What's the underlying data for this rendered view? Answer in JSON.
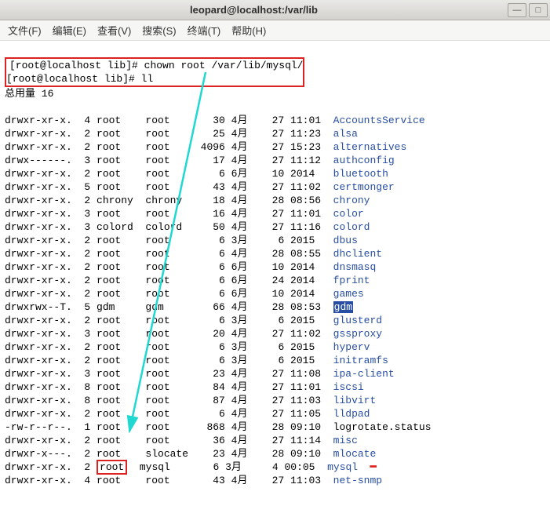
{
  "window": {
    "title": "leopard@localhost:/var/lib",
    "min": "—",
    "max": "□"
  },
  "menu": {
    "file": "文件(F)",
    "edit": "编辑(E)",
    "view": "查看(V)",
    "search": "搜索(S)",
    "terminal": "终端(T)",
    "help": "帮助(H)"
  },
  "prompt1_pre": "[root@localhost lib]# ",
  "cmd1": "chown root /var/lib/mysql/",
  "prompt2_pre": "[root@localhost lib]# ",
  "cmd2": "ll",
  "total": "总用量 16",
  "rows": [
    {
      "perm": "drwxr-xr-x.",
      "n": "4",
      "own": "root",
      "grp": "root",
      "sz": "30",
      "mon": "4月",
      "day": "27",
      "time": "11:01",
      "name": "AccountsService",
      "cls": "blue"
    },
    {
      "perm": "drwxr-xr-x.",
      "n": "2",
      "own": "root",
      "grp": "root",
      "sz": "25",
      "mon": "4月",
      "day": "27",
      "time": "11:23",
      "name": "alsa",
      "cls": "blue"
    },
    {
      "perm": "drwxr-xr-x.",
      "n": "2",
      "own": "root",
      "grp": "root",
      "sz": "4096",
      "mon": "4月",
      "day": "27",
      "time": "15:23",
      "name": "alternatives",
      "cls": "blue"
    },
    {
      "perm": "drwx------.",
      "n": "3",
      "own": "root",
      "grp": "root",
      "sz": "17",
      "mon": "4月",
      "day": "27",
      "time": "11:12",
      "name": "authconfig",
      "cls": "blue"
    },
    {
      "perm": "drwxr-xr-x.",
      "n": "2",
      "own": "root",
      "grp": "root",
      "sz": "6",
      "mon": "6月",
      "day": "10",
      "time": "2014",
      "name": "bluetooth",
      "cls": "blue"
    },
    {
      "perm": "drwxr-xr-x.",
      "n": "5",
      "own": "root",
      "grp": "root",
      "sz": "43",
      "mon": "4月",
      "day": "27",
      "time": "11:02",
      "name": "certmonger",
      "cls": "blue"
    },
    {
      "perm": "drwxr-xr-x.",
      "n": "2",
      "own": "chrony",
      "grp": "chrony",
      "sz": "18",
      "mon": "4月",
      "day": "28",
      "time": "08:56",
      "name": "chrony",
      "cls": "blue"
    },
    {
      "perm": "drwxr-xr-x.",
      "n": "3",
      "own": "root",
      "grp": "root",
      "sz": "16",
      "mon": "4月",
      "day": "27",
      "time": "11:01",
      "name": "color",
      "cls": "blue"
    },
    {
      "perm": "drwxr-xr-x.",
      "n": "3",
      "own": "colord",
      "grp": "colord",
      "sz": "50",
      "mon": "4月",
      "day": "27",
      "time": "11:16",
      "name": "colord",
      "cls": "blue"
    },
    {
      "perm": "drwxr-xr-x.",
      "n": "2",
      "own": "root",
      "grp": "root",
      "sz": "6",
      "mon": "3月",
      "day": "6",
      "time": "2015",
      "name": "dbus",
      "cls": "blue"
    },
    {
      "perm": "drwxr-xr-x.",
      "n": "2",
      "own": "root",
      "grp": "root",
      "sz": "6",
      "mon": "4月",
      "day": "28",
      "time": "08:55",
      "name": "dhclient",
      "cls": "blue"
    },
    {
      "perm": "drwxr-xr-x.",
      "n": "2",
      "own": "root",
      "grp": "root",
      "sz": "6",
      "mon": "6月",
      "day": "10",
      "time": "2014",
      "name": "dnsmasq",
      "cls": "blue"
    },
    {
      "perm": "drwxr-xr-x.",
      "n": "2",
      "own": "root",
      "grp": "root",
      "sz": "6",
      "mon": "6月",
      "day": "24",
      "time": "2014",
      "name": "fprint",
      "cls": "blue"
    },
    {
      "perm": "drwxr-xr-x.",
      "n": "2",
      "own": "root",
      "grp": "root",
      "sz": "6",
      "mon": "6月",
      "day": "10",
      "time": "2014",
      "name": "games",
      "cls": "blue"
    },
    {
      "perm": "drwxrwx--T.",
      "n": "5",
      "own": "gdm",
      "grp": "gdm",
      "sz": "66",
      "mon": "4月",
      "day": "28",
      "time": "08:53",
      "name": "gdm",
      "cls": "gdm"
    },
    {
      "perm": "drwxr-xr-x.",
      "n": "2",
      "own": "root",
      "grp": "root",
      "sz": "6",
      "mon": "3月",
      "day": "6",
      "time": "2015",
      "name": "glusterd",
      "cls": "blue"
    },
    {
      "perm": "drwxr-xr-x.",
      "n": "3",
      "own": "root",
      "grp": "root",
      "sz": "20",
      "mon": "4月",
      "day": "27",
      "time": "11:02",
      "name": "gssproxy",
      "cls": "blue"
    },
    {
      "perm": "drwxr-xr-x.",
      "n": "2",
      "own": "root",
      "grp": "root",
      "sz": "6",
      "mon": "3月",
      "day": "6",
      "time": "2015",
      "name": "hyperv",
      "cls": "blue"
    },
    {
      "perm": "drwxr-xr-x.",
      "n": "2",
      "own": "root",
      "grp": "root",
      "sz": "6",
      "mon": "3月",
      "day": "6",
      "time": "2015",
      "name": "initramfs",
      "cls": "blue"
    },
    {
      "perm": "drwxr-xr-x.",
      "n": "3",
      "own": "root",
      "grp": "root",
      "sz": "23",
      "mon": "4月",
      "day": "27",
      "time": "11:08",
      "name": "ipa-client",
      "cls": "blue"
    },
    {
      "perm": "drwxr-xr-x.",
      "n": "8",
      "own": "root",
      "grp": "root",
      "sz": "84",
      "mon": "4月",
      "day": "27",
      "time": "11:01",
      "name": "iscsi",
      "cls": "blue"
    },
    {
      "perm": "drwxr-xr-x.",
      "n": "8",
      "own": "root",
      "grp": "root",
      "sz": "87",
      "mon": "4月",
      "day": "27",
      "time": "11:03",
      "name": "libvirt",
      "cls": "blue"
    },
    {
      "perm": "drwxr-xr-x.",
      "n": "2",
      "own": "root",
      "grp": "root",
      "sz": "6",
      "mon": "4月",
      "day": "27",
      "time": "11:05",
      "name": "lldpad",
      "cls": "blue"
    },
    {
      "perm": "-rw-r--r--.",
      "n": "1",
      "own": "root",
      "grp": "root",
      "sz": "868",
      "mon": "4月",
      "day": "28",
      "time": "09:10",
      "name": "logrotate.status",
      "cls": ""
    },
    {
      "perm": "drwxr-xr-x.",
      "n": "2",
      "own": "root",
      "grp": "root",
      "sz": "36",
      "mon": "4月",
      "day": "27",
      "time": "11:14",
      "name": "misc",
      "cls": "blue"
    },
    {
      "perm": "drwxr-x---.",
      "n": "2",
      "own": "root",
      "grp": "slocate",
      "sz": "23",
      "mon": "4月",
      "day": "28",
      "time": "09:10",
      "name": "mlocate",
      "cls": "blue"
    },
    {
      "perm": "drwxr-xr-x.",
      "n": "2",
      "own": "root",
      "grp": "mysql",
      "sz": "6",
      "mon": "3月",
      "day": "4",
      "time": "00:05",
      "name": "mysql",
      "cls": "blue",
      "mark": true
    },
    {
      "perm": "drwxr-xr-x.",
      "n": "4",
      "own": "root",
      "grp": "root",
      "sz": "43",
      "mon": "4月",
      "day": "27",
      "time": "11:03",
      "name": "net-snmp",
      "cls": "blue"
    }
  ]
}
